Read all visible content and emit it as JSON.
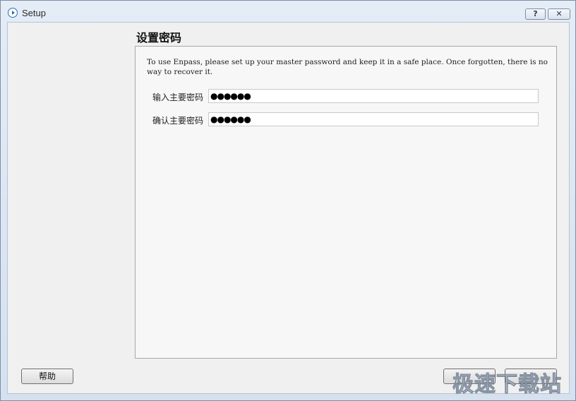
{
  "window": {
    "title": "Setup",
    "help_glyph": "?",
    "close_glyph": "✕"
  },
  "page": {
    "title": "设置密码",
    "intro": "To use Enpass, please set up your master password and keep it in a safe place. Once forgotten, there is no way to recover it."
  },
  "fields": [
    {
      "label": "输入主要密码",
      "value": "●●●●●●"
    },
    {
      "label": "确认主要密码",
      "value": "●●●●●●"
    }
  ],
  "buttons": {
    "help": "帮助",
    "back": "",
    "next": ""
  },
  "watermark": "极速下载站",
  "colors": {
    "accent": "#2c6fb5",
    "frame": "#dce6f1"
  }
}
